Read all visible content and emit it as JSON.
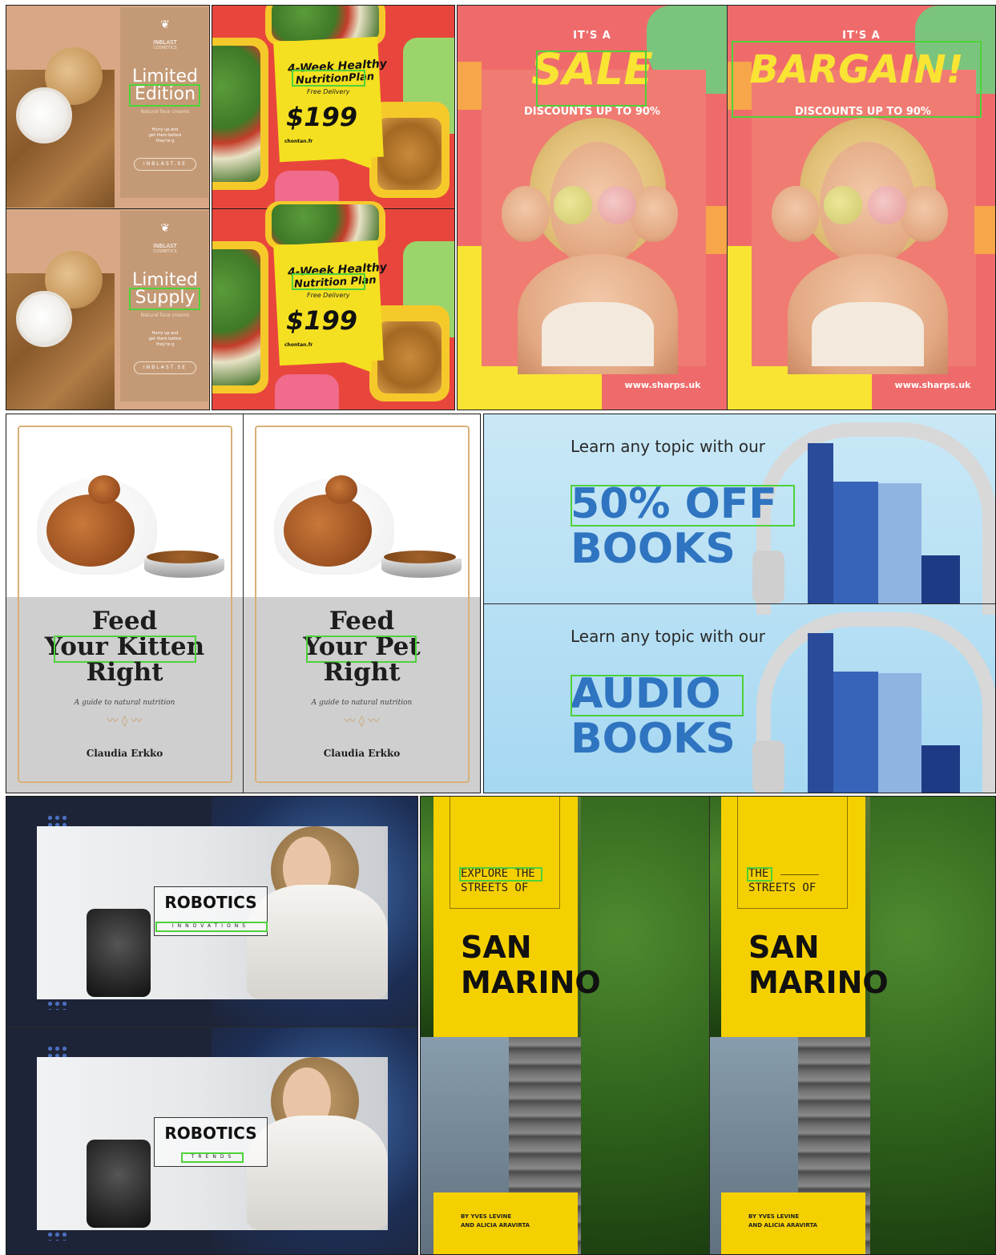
{
  "cosmetics": {
    "brand": "INBLAST",
    "brand_sub": "COSMETICS",
    "items": [
      {
        "line1": "Limited",
        "line2": "Edition",
        "tag": "Natural face creams",
        "blurb": [
          "Hurry up and",
          "get them before",
          "they're g"
        ],
        "button": "INBLAST.SE"
      },
      {
        "line1": "Limited",
        "line2": "Supply",
        "tag": "Natural face creams",
        "blurb": [
          "Hurry up and",
          "get them before",
          "they're g"
        ],
        "button": "INBLAST.SE"
      }
    ]
  },
  "food": {
    "items": [
      {
        "line1": "4-Week Healthy",
        "line2": "NutritionPlan",
        "delivery": "Free Delivery",
        "price": "$199",
        "site": "chontan.fr"
      },
      {
        "line1": "4-Week Healthy",
        "line2": "Nutrition Plan",
        "delivery": "Free Delivery",
        "price": "$199",
        "site": "chontan.fr"
      }
    ]
  },
  "sale": {
    "items": [
      {
        "kicker": "IT'S A",
        "headline": "SALE",
        "discount": "DISCOUNTS UP TO 90%",
        "site": "www.sharps.uk"
      },
      {
        "kicker": "IT'S A",
        "headline": "BARGAIN!",
        "discount": "DISCOUNTS UP TO 90%",
        "site": "www.sharps.uk"
      }
    ]
  },
  "petbook": {
    "items": [
      {
        "line1": "Feed",
        "line2": "Your Kitten",
        "line3": "Right",
        "subtitle": "A guide to natural nutrition",
        "author": "Claudia Erkko"
      },
      {
        "line1": "Feed",
        "line2": "Your Pet",
        "line3": "Right",
        "subtitle": "A guide to natural nutrition",
        "author": "Claudia Erkko"
      }
    ]
  },
  "books": {
    "items": [
      {
        "intro": "Learn any topic with our",
        "line1": "50% OFF",
        "line2": "BOOKS"
      },
      {
        "intro": "Learn any topic with our",
        "line1": "AUDIO",
        "line2": "BOOKS"
      }
    ]
  },
  "robotics": {
    "items": [
      {
        "title": "ROBOTICS",
        "tag": "INNOVATIONS"
      },
      {
        "title": "ROBOTICS",
        "tag": "TRENDS"
      }
    ]
  },
  "sanmarino": {
    "items": [
      {
        "kicker1": "EXPLORE THE",
        "kicker2": "STREETS OF",
        "city1": "SAN",
        "city2": "MARINO",
        "by1": "BY YVES LEVINE",
        "by2": "AND ALICIA ARAVIRTA"
      },
      {
        "kicker1": "THE",
        "kicker2": "STREETS OF",
        "city1": "SAN",
        "city2": "MARINO",
        "by1": "BY YVES LEVINE",
        "by2": "AND ALICIA ARAVIRTA"
      }
    ]
  },
  "colors": {
    "highlight": "#4dd23a",
    "sale_yellow": "#f9e433",
    "books_blue": "#2f74c0",
    "sanmarino_yellow": "#f5d000"
  }
}
